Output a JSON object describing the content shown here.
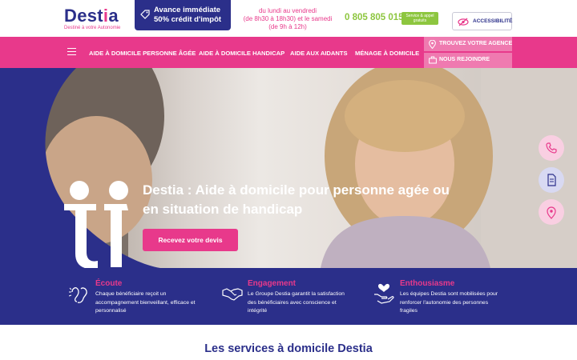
{
  "brand": {
    "name_pre": "Dest",
    "name_i": "i",
    "name_post": "a",
    "tagline": "Destiné à votre Autonomie"
  },
  "promo": {
    "line1": "Avance immédiate",
    "line2": "50% crédit d'impôt"
  },
  "hours": {
    "line1": "du lundi au vendredi",
    "line2": "(de 8h30 à 18h30) et le samedi",
    "line3": "(de 9h à 12h)"
  },
  "phone": {
    "number": "0 805 805 015",
    "badge_line1": "Service & appel",
    "badge_line2": "gratuits"
  },
  "accessibility": {
    "label": "ACCESSIBILITÉ"
  },
  "nav": {
    "items": [
      {
        "label": "AIDE À DOMICILE PERSONNE ÂGÉE"
      },
      {
        "label": "AIDE À DOMICILE HANDICAP"
      },
      {
        "label": "AIDE AUX AIDANTS"
      },
      {
        "label": "MÉNAGE À DOMICILE"
      }
    ],
    "agence": "TROUVEZ VOTRE AGENCE",
    "rejoindre": "NOUS REJOINDRE"
  },
  "hero": {
    "title": "Destia : Aide à domicile pour personne agée ou en situation de handicap",
    "cta": "Recevez votre devis"
  },
  "side_buttons": [
    {
      "icon": "phone-icon"
    },
    {
      "icon": "document-icon"
    },
    {
      "icon": "location-pin-icon"
    }
  ],
  "values": [
    {
      "title": "Écoute",
      "icon": "ear-icon",
      "text": "Chaque bénéficiaire reçoit un accompagnement bienveillant, efficace et personnalisé"
    },
    {
      "title": "Engagement",
      "icon": "handshake-icon",
      "text": "Le Groupe Destia garantit la satisfaction des bénéficiaires avec conscience et intégrité"
    },
    {
      "title": "Enthousiasme",
      "icon": "heart-hands-icon",
      "text": "Les équipes Destia sont mobilisées pour renforcer l'autonomie des personnes fragiles"
    }
  ],
  "section": {
    "title": "Les services à domicile Destia"
  },
  "colors": {
    "brand_blue": "#2b2f8a",
    "brand_pink": "#e8398b",
    "light_pink": "#ef7ab0",
    "green": "#8dc63f"
  }
}
